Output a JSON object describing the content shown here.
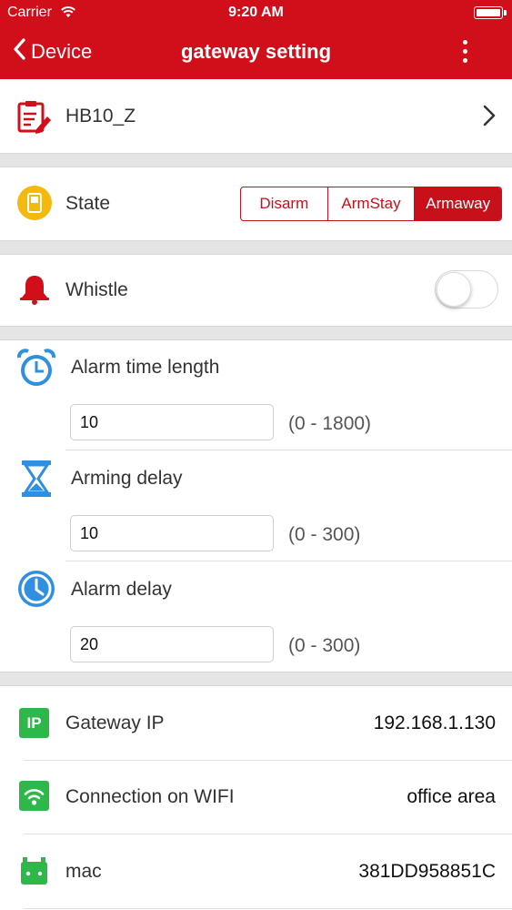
{
  "status_bar": {
    "carrier": "Carrier",
    "time": "9:20 AM"
  },
  "nav": {
    "back_label": "Device",
    "title": "gateway setting"
  },
  "device": {
    "name": "HB10_Z"
  },
  "state": {
    "label": "State",
    "options": [
      "Disarm",
      "ArmStay",
      "Armaway"
    ],
    "selected": "Armaway"
  },
  "whistle": {
    "label": "Whistle",
    "enabled": false
  },
  "alarm_time_length": {
    "label": "Alarm time length",
    "value": "10",
    "range": "(0 - 1800)"
  },
  "arming_delay": {
    "label": "Arming delay",
    "value": "10",
    "range": "(0 - 300)"
  },
  "alarm_delay": {
    "label": "Alarm delay",
    "value": "20",
    "range": "(0 - 300)"
  },
  "gateway_ip": {
    "icon_text": "IP",
    "label": "Gateway IP",
    "value": "192.168.1.130"
  },
  "wifi": {
    "label": "Connection on WIFI",
    "value": "office area"
  },
  "mac": {
    "label": "mac",
    "value": "381DD958851C"
  },
  "colors": {
    "brand_red": "#d00f1a",
    "blue": "#2f8fe0",
    "green": "#2fb84a",
    "yellow": "#f3b90f"
  }
}
